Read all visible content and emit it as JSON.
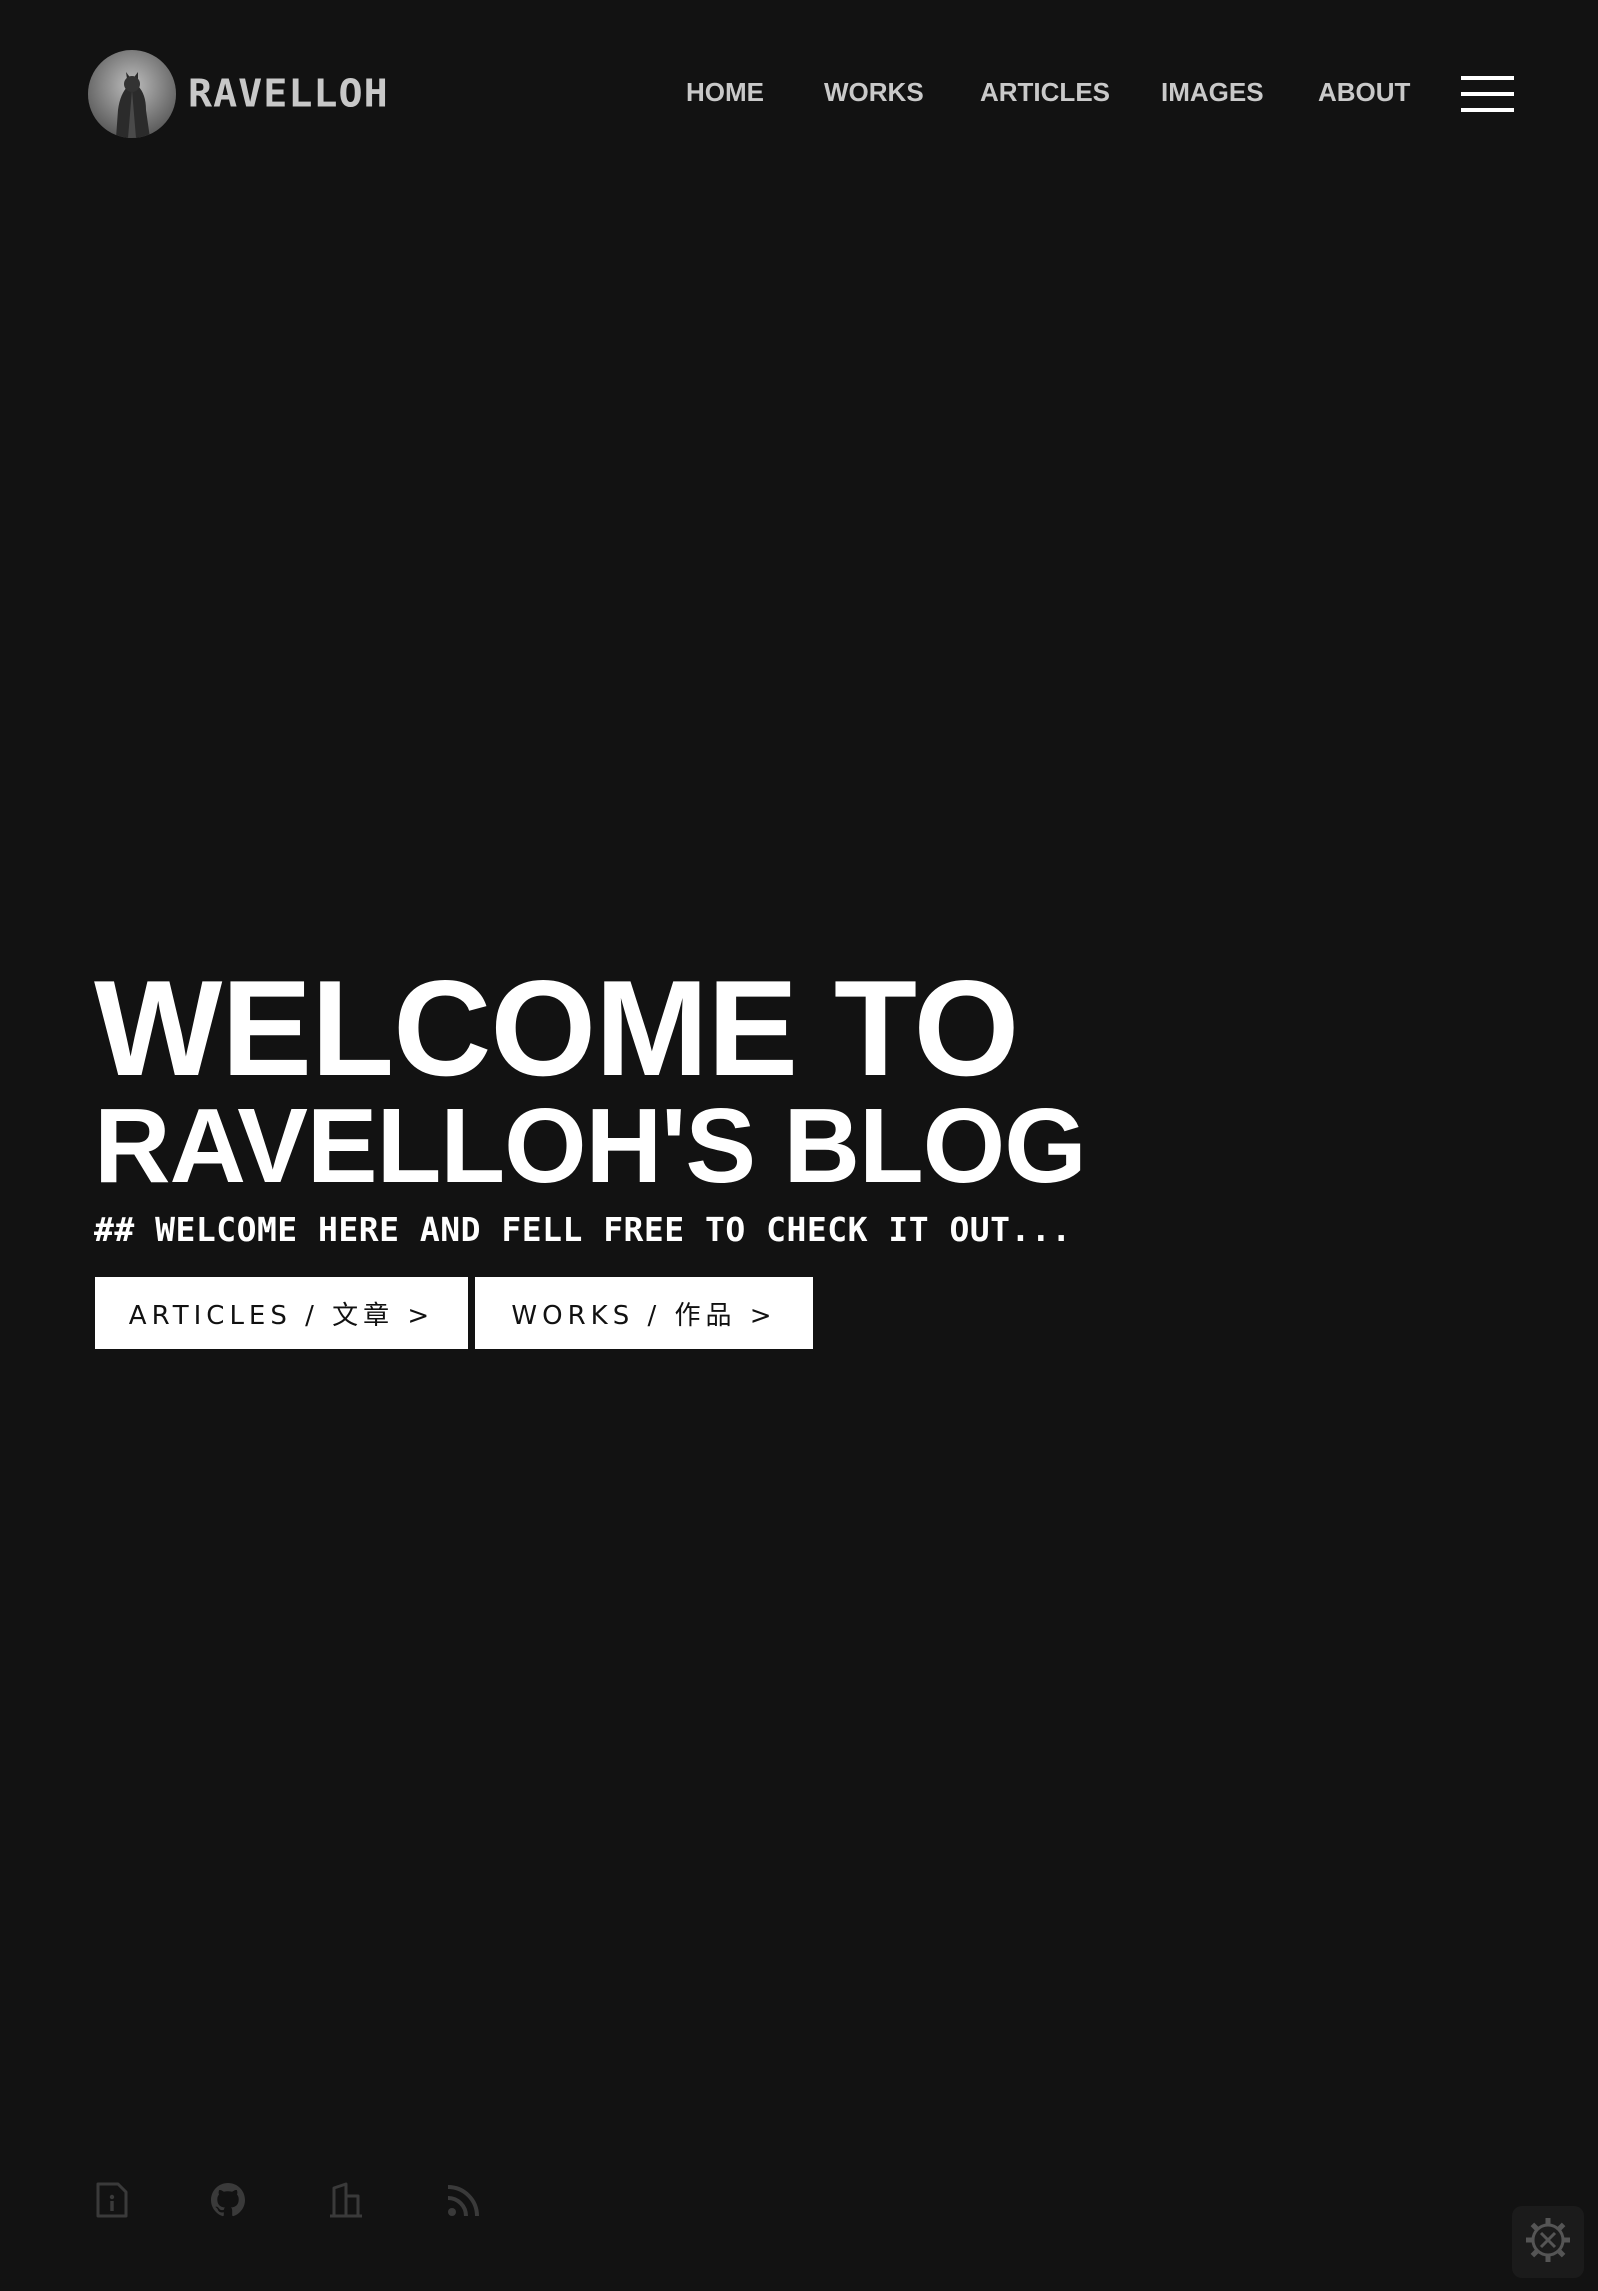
{
  "site": {
    "brand_name": "RAVELLOH"
  },
  "nav": {
    "items": [
      {
        "label": "HOME"
      },
      {
        "label": "WORKS"
      },
      {
        "label": "ARTICLES"
      },
      {
        "label": "IMAGES"
      },
      {
        "label": "ABOUT"
      }
    ],
    "menu_icon": "hamburger-icon"
  },
  "hero": {
    "title_line1": "WELCOME TO",
    "title_line2": "RAVELLOH'S BLOG",
    "subtitle": "## WELCOME HERE AND FELL FREE TO CHECK IT OUT...",
    "buttons": [
      {
        "label": "ARTICLES / 文章 >"
      },
      {
        "label": "WORKS / 作品 >"
      }
    ]
  },
  "social": [
    {
      "icon": "info-document-icon"
    },
    {
      "icon": "github-icon"
    },
    {
      "icon": "building-icon"
    },
    {
      "icon": "rss-icon"
    }
  ],
  "settings_icon": "gear-icon",
  "colors": {
    "background": "#121212",
    "text": "#ffffff",
    "nav_text": "#c9c9c9",
    "icon_dim": "#3a3a3a",
    "button_bg": "#ffffff",
    "button_text": "#111111"
  }
}
